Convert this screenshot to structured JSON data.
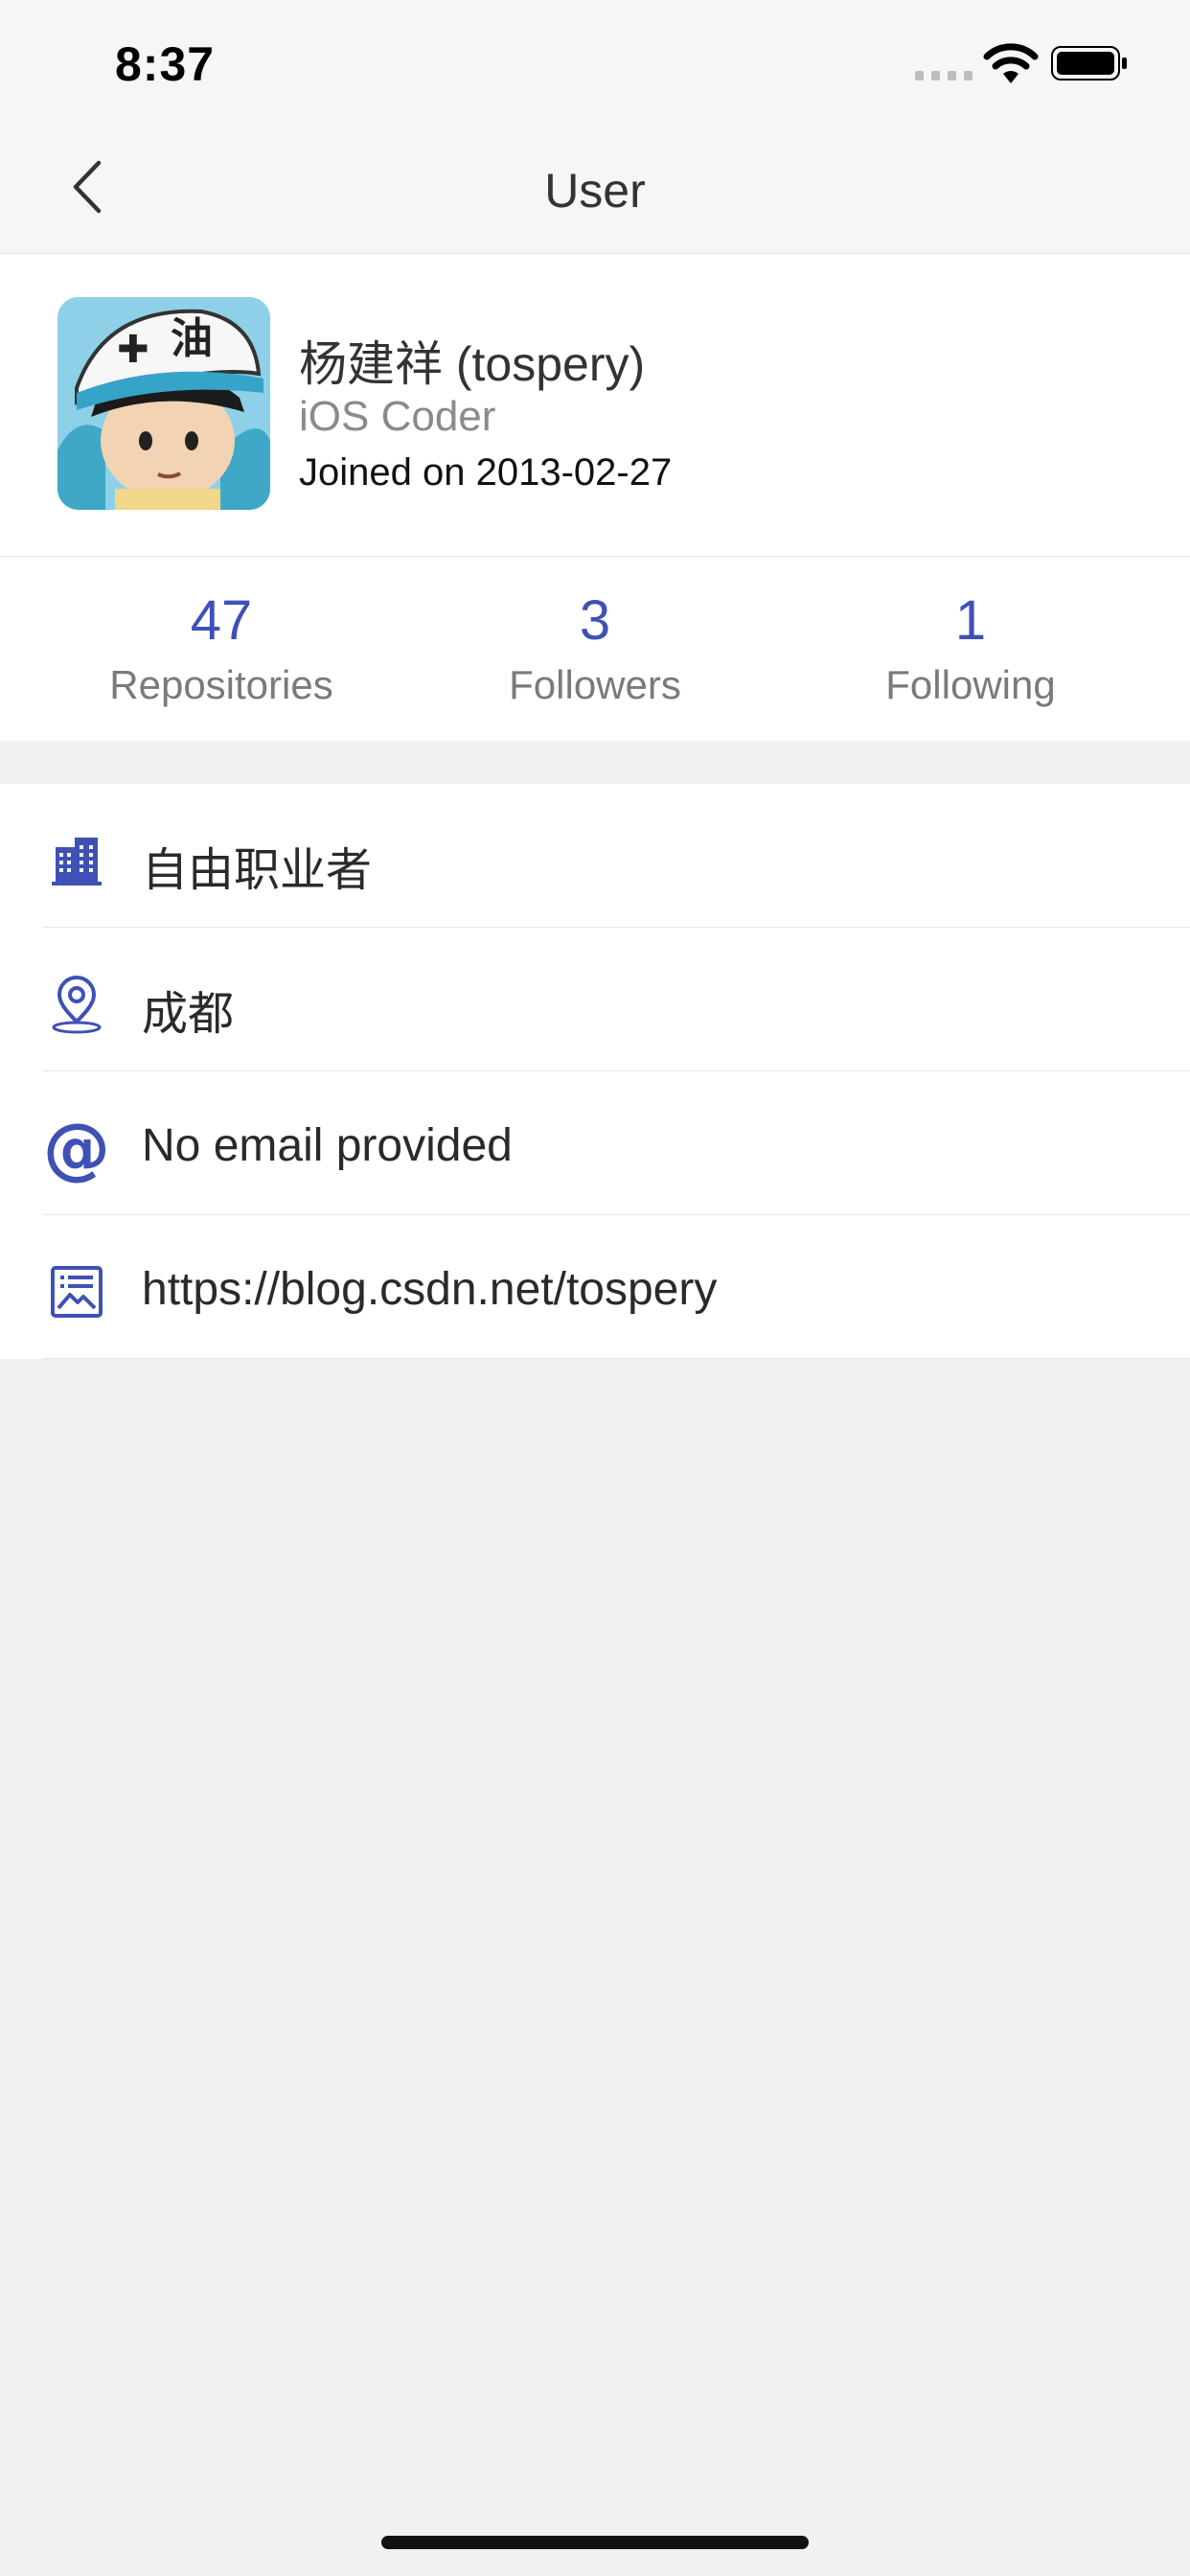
{
  "status_bar": {
    "time": "8:37"
  },
  "nav": {
    "title": "User"
  },
  "profile": {
    "name": "杨建祥 (tospery)",
    "bio": "iOS Coder",
    "joined": "Joined on 2013-02-27"
  },
  "stats": [
    {
      "count": "47",
      "label": "Repositories"
    },
    {
      "count": "3",
      "label": "Followers"
    },
    {
      "count": "1",
      "label": "Following"
    }
  ],
  "details": [
    {
      "icon": "building-icon",
      "text": "自由职业者"
    },
    {
      "icon": "location-pin-icon",
      "text": "成都"
    },
    {
      "icon": "at-sign-icon",
      "text": "No email provided"
    },
    {
      "icon": "blog-icon",
      "text": "https://blog.csdn.net/tospery"
    }
  ],
  "colors": {
    "accent": "#3f51b5",
    "background": "#f1f1f1"
  }
}
